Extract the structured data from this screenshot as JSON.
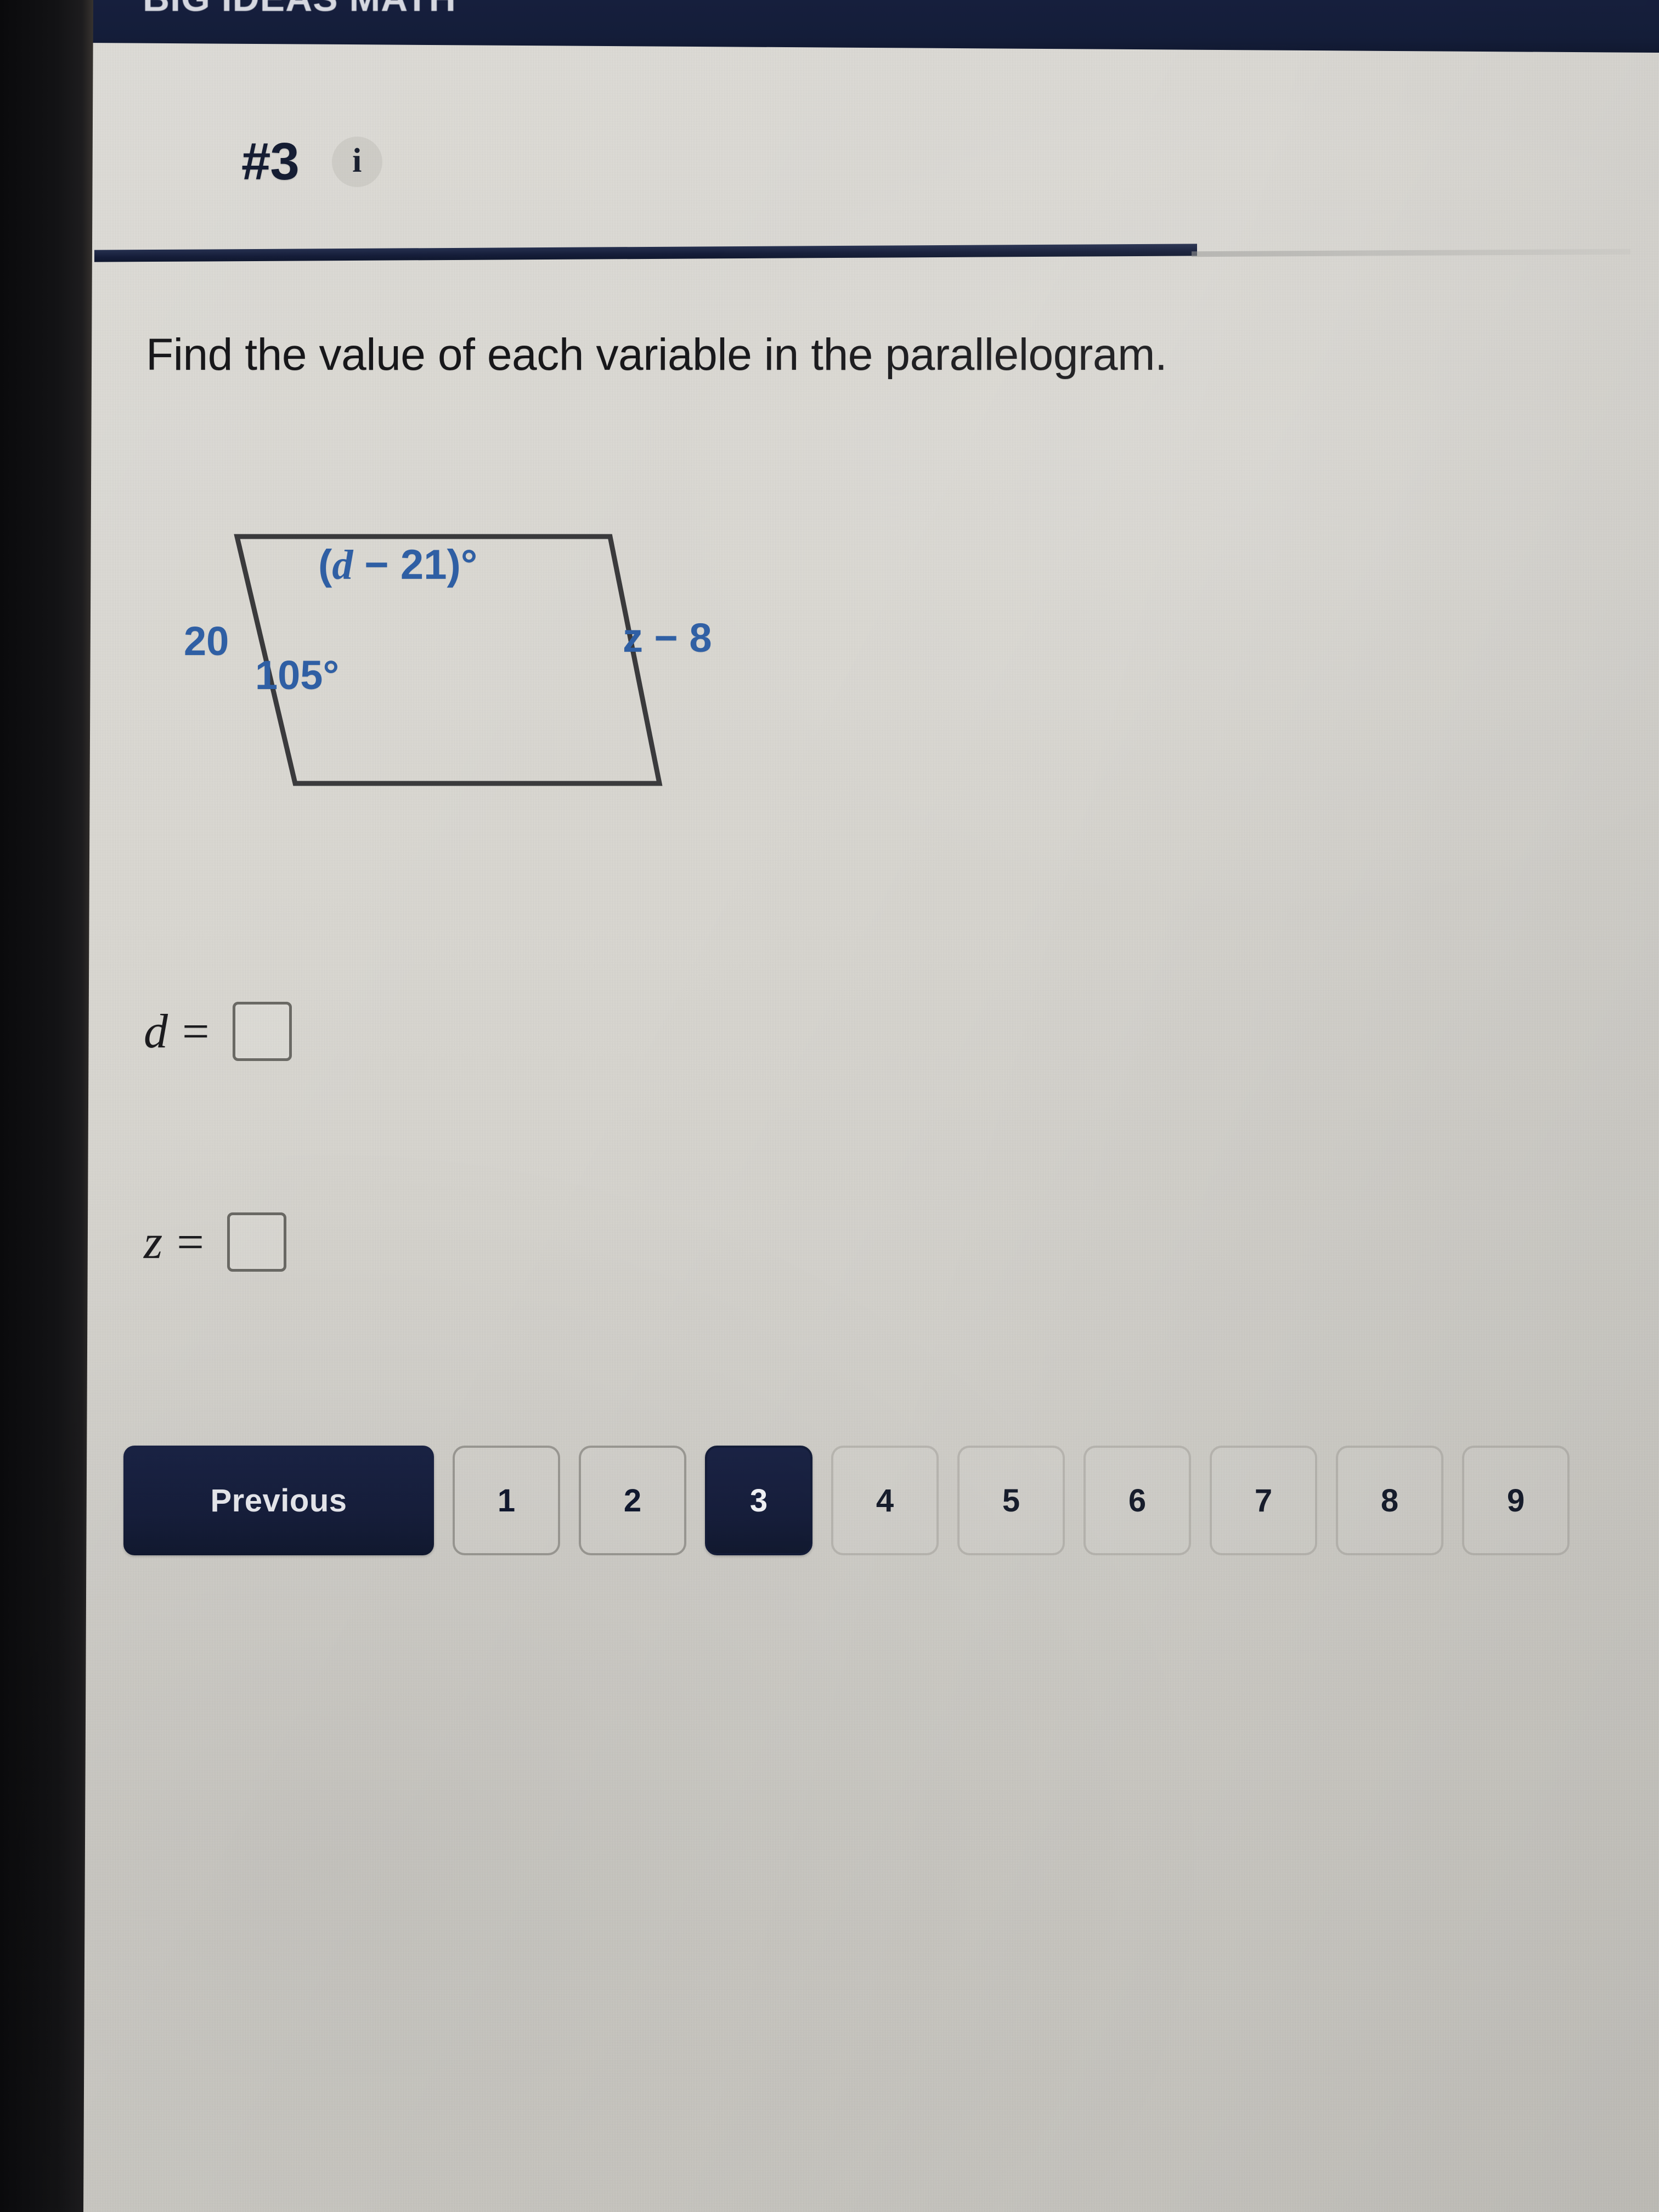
{
  "app": {
    "banner_title": "BIG IDEAS MATH",
    "banner_color": "#141d39"
  },
  "header": {
    "question_number": "#3",
    "info_icon_label": "i"
  },
  "prompt": {
    "text": "Find the value of each variable in the parallelogram."
  },
  "figure": {
    "type": "parallelogram",
    "label_color": "#2f5fa4",
    "outline_color": "#3a3a3c",
    "labels": {
      "top_interior_angle": "(d − 21)°",
      "top_interior_angle_var": "d",
      "right_side": "z − 8",
      "left_side": "20",
      "bottom_left_angle": "105°"
    }
  },
  "answers": [
    {
      "name": "d",
      "label": "d =",
      "value": "",
      "placeholder": ""
    },
    {
      "name": "z",
      "label": "z =",
      "value": "",
      "placeholder": ""
    }
  ],
  "pagination": {
    "previous_label": "Previous",
    "active_page": "3",
    "pages": [
      {
        "label": "1",
        "state": "normal"
      },
      {
        "label": "2",
        "state": "normal"
      },
      {
        "label": "3",
        "state": "active"
      },
      {
        "label": "4",
        "state": "faded"
      },
      {
        "label": "5",
        "state": "faded"
      },
      {
        "label": "6",
        "state": "faded"
      },
      {
        "label": "7",
        "state": "faded"
      },
      {
        "label": "8",
        "state": "faded"
      },
      {
        "label": "9",
        "state": "faded"
      }
    ]
  }
}
